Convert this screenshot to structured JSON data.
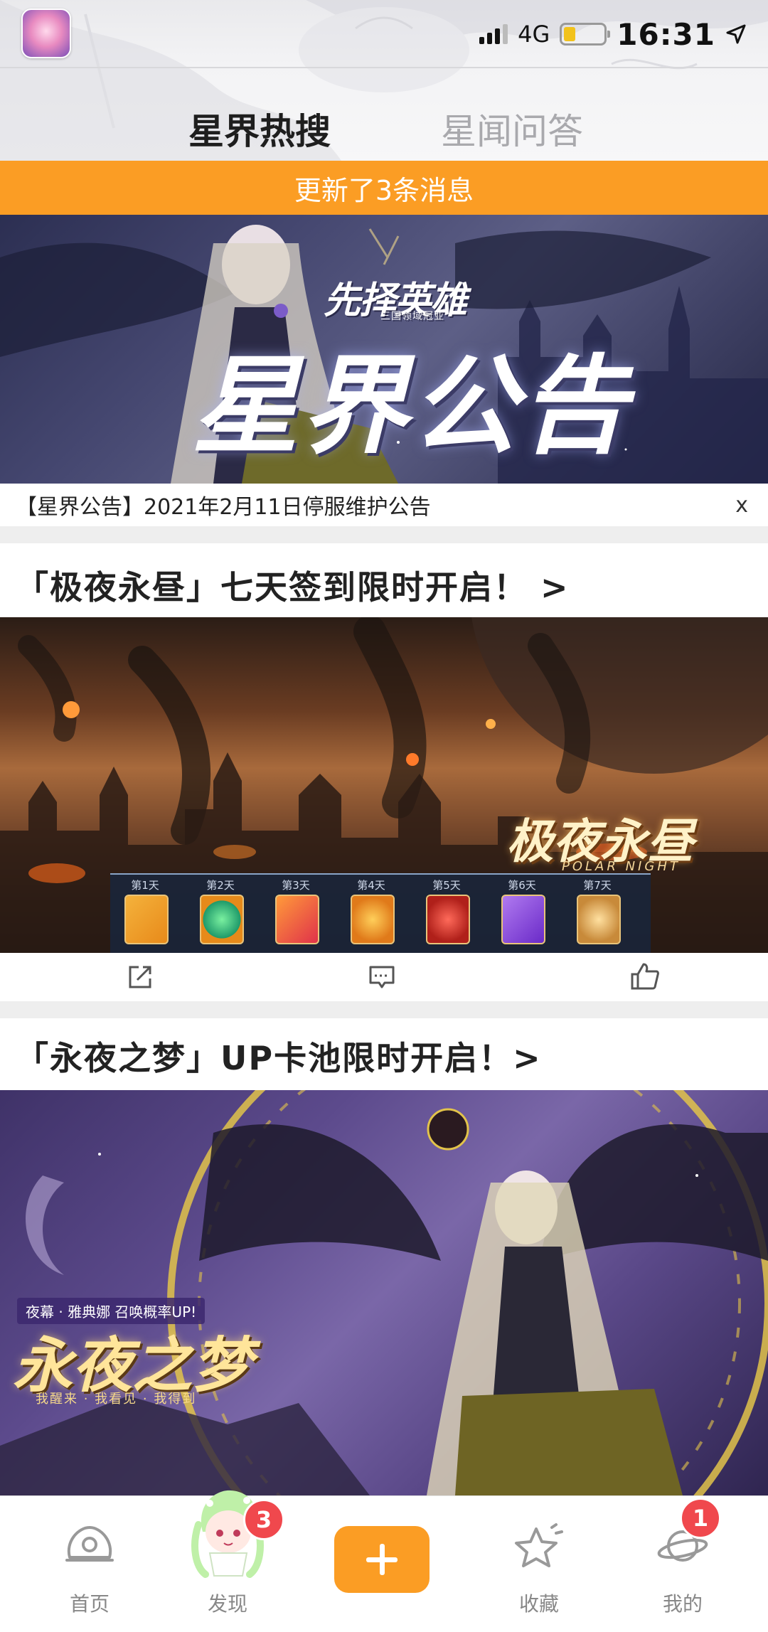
{
  "status_bar": {
    "network": "4G",
    "time": "16:31"
  },
  "tabs": [
    {
      "label": "星界热搜",
      "active": true
    },
    {
      "label": "星闻问答",
      "active": false
    }
  ],
  "update_banner": "更新了3条消息",
  "announcement": {
    "banner_subtitle": "先择英雄",
    "banner_subtitle_small": "三国领域冠亚",
    "banner_title": "星界公告",
    "text": "【星界公告】2021年2月11日停服维护公告",
    "close": "x"
  },
  "posts": [
    {
      "title": "「极夜永昼」七天签到限时开启！ >",
      "banner_title": "极夜永昼",
      "banner_sub": "POLAR NIGHT",
      "days": [
        "第1天",
        "第2天",
        "第3天",
        "第4天",
        "第5天",
        "第6天",
        "第7天"
      ]
    },
    {
      "title": "「永夜之梦」UP卡池限时开启！>",
      "banner_tag": "夜幕 · 雅典娜 召唤概率UP!",
      "banner_title": "永夜之梦",
      "banner_sub": "我醒来 · 我看见 · 我得到"
    }
  ],
  "actions": [
    "share-icon",
    "comment-icon",
    "like-icon"
  ],
  "bottom_nav": {
    "items": [
      {
        "label": "首页",
        "icon": "home-icon"
      },
      {
        "label": "发现",
        "icon": "discover-mascot",
        "badge": "3"
      },
      {
        "label": "",
        "icon": "plus-icon"
      },
      {
        "label": "收藏",
        "icon": "star-icon"
      },
      {
        "label": "我的",
        "icon": "planet-icon",
        "badge": "1"
      }
    ]
  },
  "colors": {
    "accent": "#fb9d24",
    "badge": "#f0484d"
  }
}
